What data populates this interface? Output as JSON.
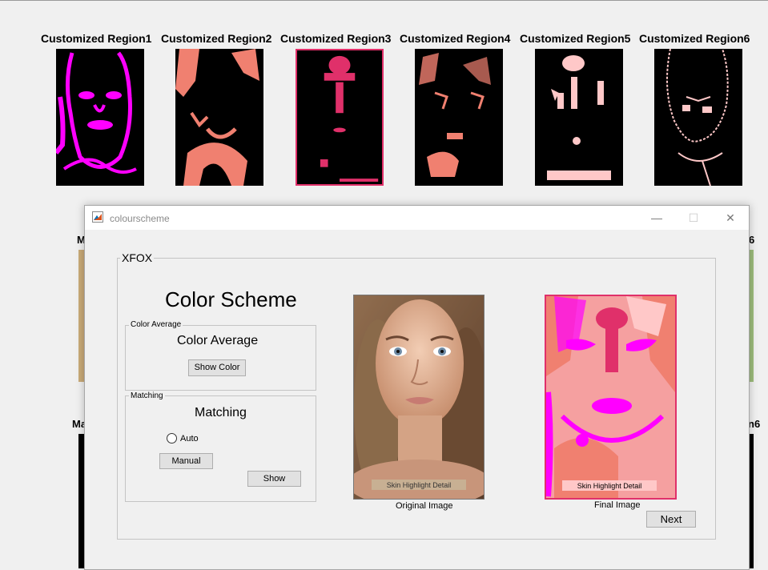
{
  "regions_window": {
    "titles": [
      "Customized Region1",
      "Customized Region2",
      "Customized Region3",
      "Customized Region4",
      "Customized Region5",
      "Customized Region6"
    ],
    "colors": [
      "#ff00ff",
      "#f08070",
      "#e0306a",
      "#f08070",
      "#ffc8c8",
      "#ffc8c8"
    ]
  },
  "bg_window_partial": {
    "left_label_1": "M",
    "right_label_1": "6",
    "left_label_2": "Ma",
    "right_label_2": "n6"
  },
  "dialog": {
    "title": "colourscheme",
    "window_controls": {
      "minimize": "—",
      "maximize": "☐",
      "close": "✕"
    },
    "group_label": "XFOX",
    "heading": "Color Scheme",
    "color_average": {
      "legend": "Color Average",
      "label": "Color Average",
      "button": "Show Color"
    },
    "matching": {
      "legend": "Matching",
      "label": "Matching",
      "radio_label": "Auto",
      "manual_button": "Manual",
      "show_button": "Show"
    },
    "original_caption": "Original Image",
    "final_caption": "Final Image",
    "palette_text": "Skin Highlight Detail",
    "palette_text_final": "Skin Highlight Detail",
    "next_button": "Next"
  }
}
